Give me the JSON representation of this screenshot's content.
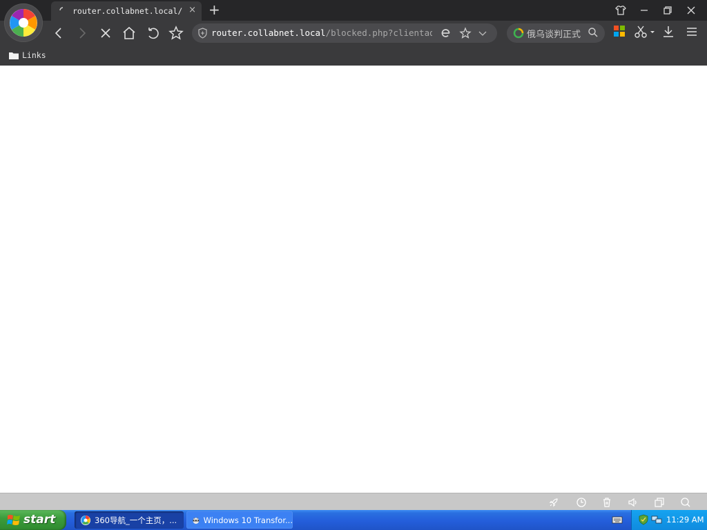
{
  "browser": {
    "tab": {
      "title": "router.collabnet.local/blo",
      "close_glyph": "×"
    },
    "new_tab_glyph": "+",
    "address": {
      "host": "router.collabnet.local",
      "path": "/blocked.php?clientaddr"
    },
    "search": {
      "term": "俄乌谈判正式"
    },
    "bookmarks": [
      {
        "label": "Links",
        "icon": "folder-icon"
      }
    ]
  },
  "taskbar": {
    "start_label": "start",
    "tasks": [
      {
        "label": "360导航_一个主页，...",
        "icon": "browser-360-icon",
        "active": true
      },
      {
        "label": "Windows 10 Transfor...",
        "icon": "raccoon-icon",
        "active": false
      }
    ],
    "clock": "11:29 AM"
  },
  "colors": {
    "chrome_bg": "#3a3a3c",
    "tabstrip_bg": "#262628",
    "statusbar_bg": "#c8c8c8",
    "taskbar_blue": "#245edb",
    "start_green": "#3c9c3c",
    "tray_blue": "#0f8bdf"
  }
}
